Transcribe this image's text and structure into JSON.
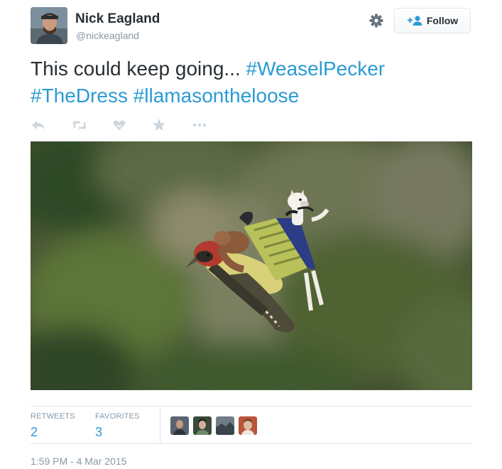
{
  "author": {
    "name": "Nick Eagland",
    "handle": "@nickeagland"
  },
  "follow_label": "Follow",
  "tweet": {
    "text_plain": "This could keep going... ",
    "hashtags": [
      "#WeaselPecker",
      "#TheDress",
      "#llamasontheloose"
    ]
  },
  "actions": [
    {
      "name": "reply",
      "icon": "reply-icon"
    },
    {
      "name": "retweet",
      "icon": "retweet-icon"
    },
    {
      "name": "like",
      "icon": "heart-icon"
    },
    {
      "name": "favorite",
      "icon": "star-icon"
    },
    {
      "name": "more",
      "icon": "more-icon"
    }
  ],
  "stats": {
    "retweets_label": "RETWEETS",
    "retweets_count": "2",
    "favorites_label": "FAVORITES",
    "favorites_count": "3"
  },
  "timestamp": "1:59 PM - 4 Mar 2015",
  "colors": {
    "hashtag": "#2b9bd3",
    "muted": "#8899a6",
    "text": "#292f33",
    "border": "#e1e8ed"
  }
}
